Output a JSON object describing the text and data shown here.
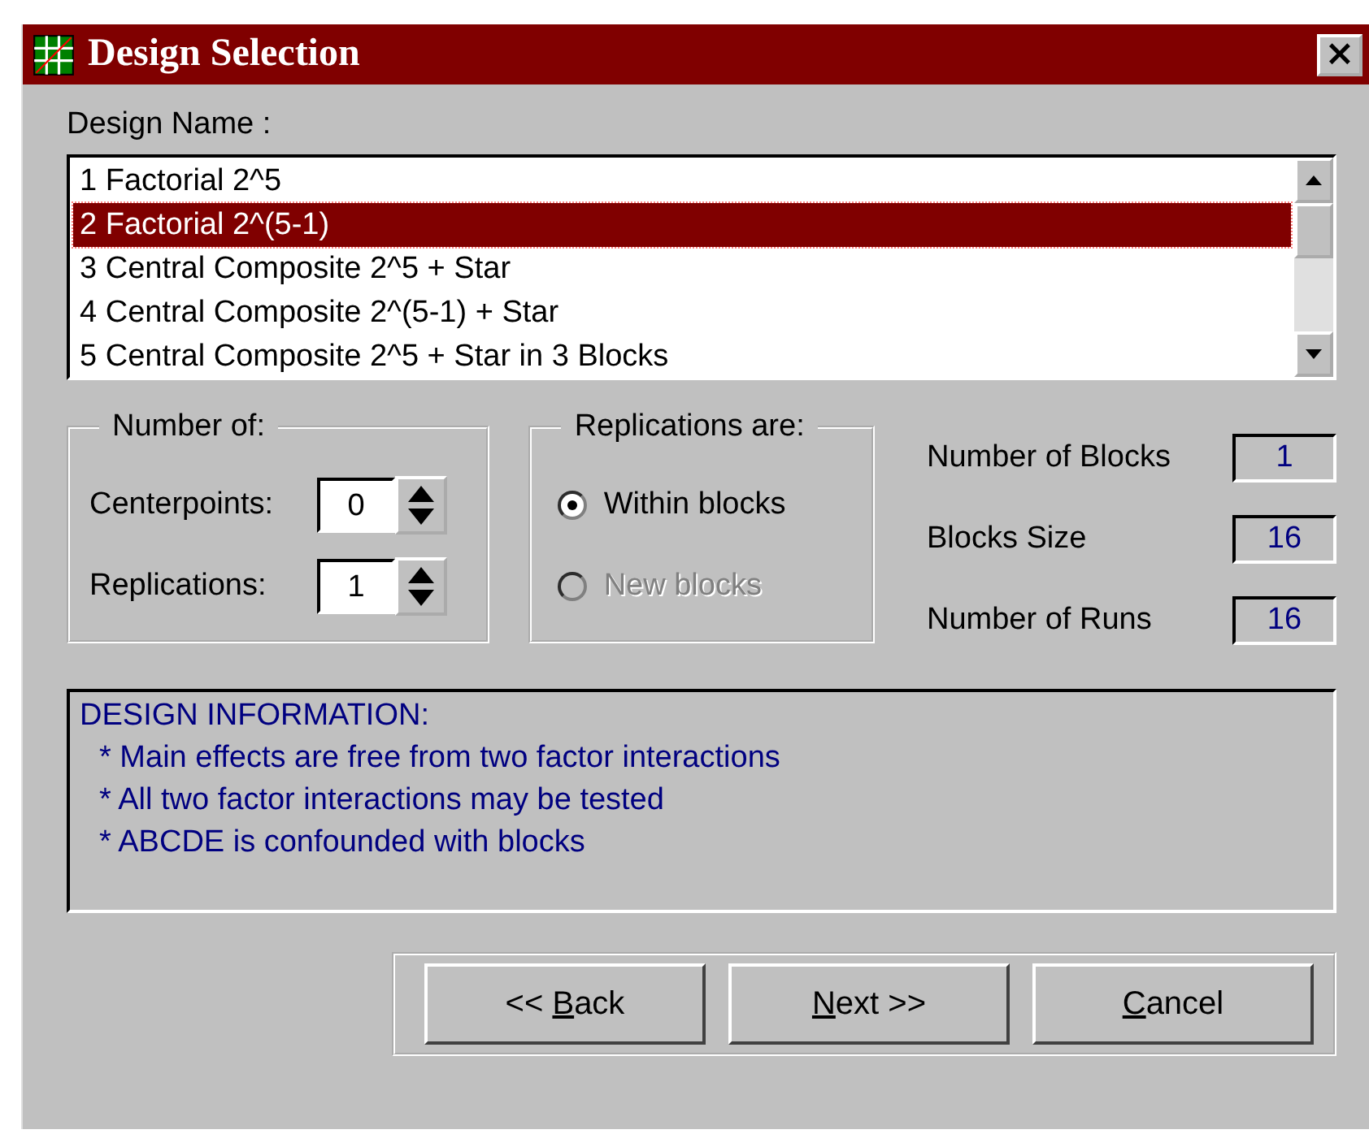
{
  "window": {
    "title": "Design Selection",
    "close": "×"
  },
  "design_list": {
    "label": "Design Name :",
    "items": [
      {
        "text": "1 Factorial 2^5",
        "selected": false
      },
      {
        "text": "2 Factorial 2^(5-1)",
        "selected": true
      },
      {
        "text": "3 Central Composite 2^5 + Star",
        "selected": false
      },
      {
        "text": "4 Central Composite 2^(5-1) + Star",
        "selected": false
      },
      {
        "text": "5 Central Composite 2^5 + Star in 3 Blocks",
        "selected": false
      }
    ]
  },
  "number_of": {
    "title": "Number of:",
    "spinners": [
      {
        "label": "Centerpoints:",
        "value": "0"
      },
      {
        "label": "Replications:",
        "value": "1"
      }
    ]
  },
  "replications": {
    "title": "Replications are:",
    "options": [
      {
        "label": "Within blocks",
        "selected": true,
        "disabled": false
      },
      {
        "label": "New blocks",
        "selected": false,
        "disabled": true
      }
    ]
  },
  "stats": [
    {
      "label": "Number of Blocks",
      "value": "1"
    },
    {
      "label": "Blocks Size",
      "value": "16"
    },
    {
      "label": "Number of Runs",
      "value": "16"
    }
  ],
  "design_info": {
    "heading": "DESIGN INFORMATION:",
    "lines": [
      "* Main effects are free from two factor interactions",
      "* All two factor interactions may be tested",
      "* ABCDE is confounded with blocks"
    ]
  },
  "buttons": [
    {
      "before": "<< ",
      "key": "B",
      "after": "ack"
    },
    {
      "key": "N",
      "after": "ext >>"
    },
    {
      "key": "C",
      "after": "ancel"
    }
  ]
}
